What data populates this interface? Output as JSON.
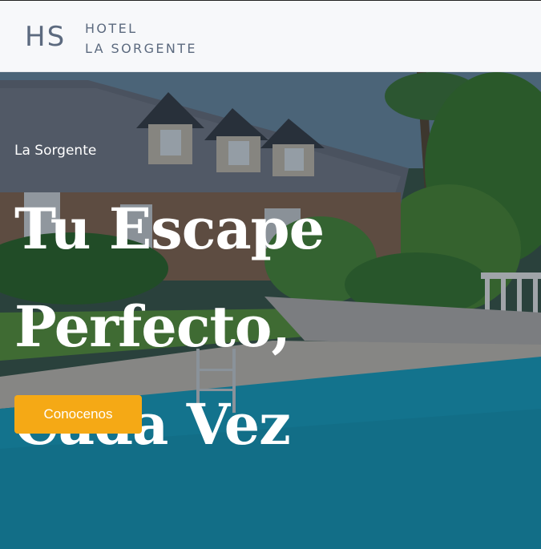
{
  "nav": {
    "initials": "HS",
    "name_line1": "HOTEL",
    "name_line2": "LA SORGENTE"
  },
  "hero": {
    "kicker": "La Sorgente",
    "headline_line1": "Tu Escape Perfecto,",
    "headline_line2": "Cada Vez",
    "cta_label": "Conocenos"
  },
  "colors": {
    "brand_text": "#5c6a7f",
    "cta": "#f5a915",
    "navbar_bg": "#f7f8fa",
    "pool": "#18a3c4"
  },
  "images": {
    "hero": "hotel-house-with-pool-photo"
  }
}
